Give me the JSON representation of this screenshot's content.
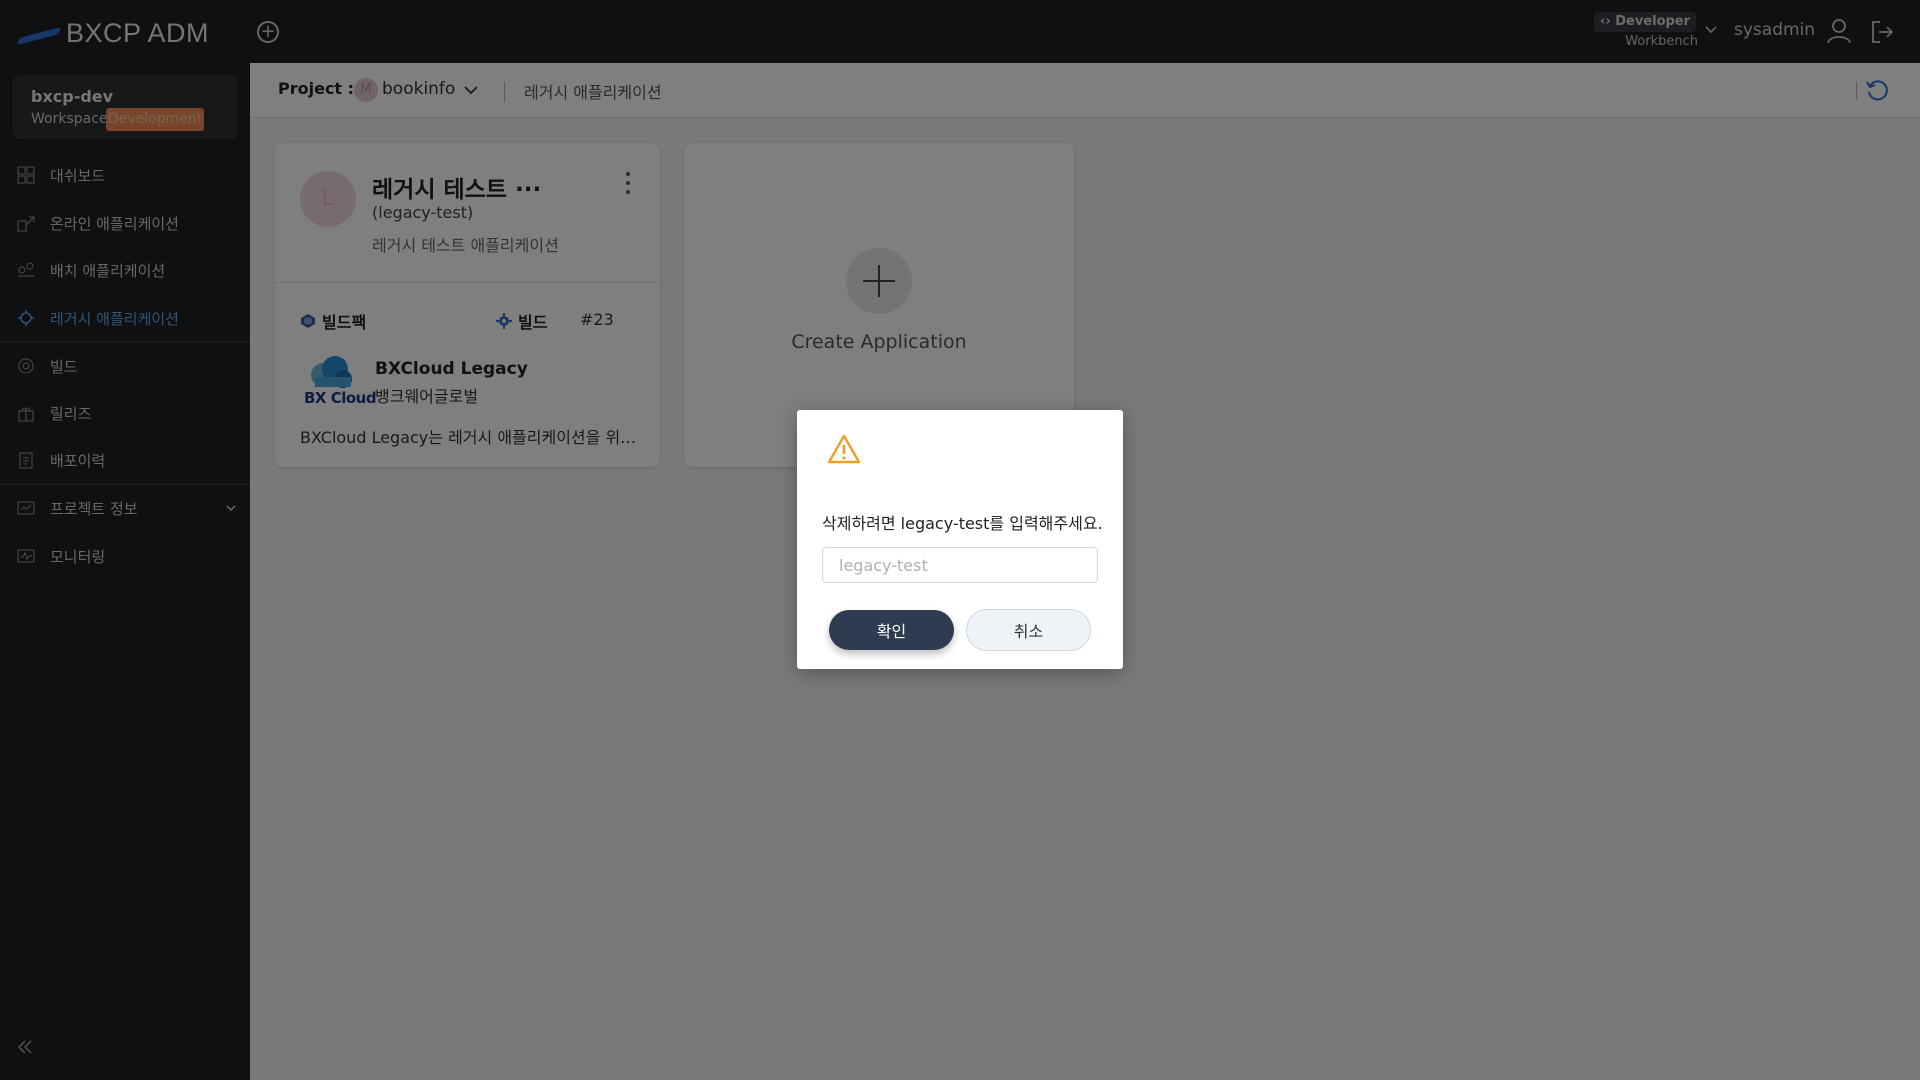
{
  "header": {
    "logo_text": "BXCP ADM",
    "role_badge": "‹› Developer",
    "role_sub": "Workbench",
    "username": "sysadmin"
  },
  "workspace": {
    "name": "bxcp-dev",
    "label": "Workspace",
    "tag": "Development"
  },
  "sidebar": {
    "items": [
      {
        "label": "대쉬보드",
        "icon": "dashboard-icon"
      },
      {
        "label": "온라인 애플리케이션",
        "icon": "online-app-icon"
      },
      {
        "label": "배치 애플리케이션",
        "icon": "batch-app-icon"
      },
      {
        "label": "레거시 애플리케이션",
        "icon": "legacy-app-icon",
        "active": true
      },
      {
        "label": "빌드",
        "icon": "build-icon"
      },
      {
        "label": "릴리즈",
        "icon": "release-icon"
      },
      {
        "label": "배포이력",
        "icon": "deploy-history-icon"
      },
      {
        "label": "프로젝트 정보",
        "icon": "project-info-icon"
      },
      {
        "label": "모니터링",
        "icon": "monitoring-icon"
      }
    ]
  },
  "breadcrumb": {
    "project_label": "Project :",
    "project_avatar": "M",
    "project_name": "bookinfo",
    "page": "레거시 애플리케이션"
  },
  "app_card": {
    "avatar": "L",
    "title": "레거시 테스트 ···",
    "subtitle": "(legacy-test)",
    "description": "레거시 테스트 애플리케이션",
    "buildpack_label": "빌드팩",
    "build_label": "빌드",
    "build_number": "#23",
    "buildpack_logo_text": "BX Cloud",
    "buildpack_name": "BXCloud Legacy",
    "buildpack_vendor": "뱅크웨어글로벌",
    "buildpack_desc": "BXCloud Legacy는 레거시 애플리케이션을 위한 빌드팩입니다"
  },
  "create_card": {
    "label": "Create Application"
  },
  "modal": {
    "message": "삭제하려면 legacy-test를 입력해주세요.",
    "input_placeholder": "legacy-test",
    "input_value": "",
    "confirm_label": "확인",
    "cancel_label": "취소"
  },
  "colors": {
    "accent": "#5ea9e6",
    "confirm_button": "#2f3b52",
    "warning": "#f0a020",
    "workspace_tag": "#f08a55"
  }
}
